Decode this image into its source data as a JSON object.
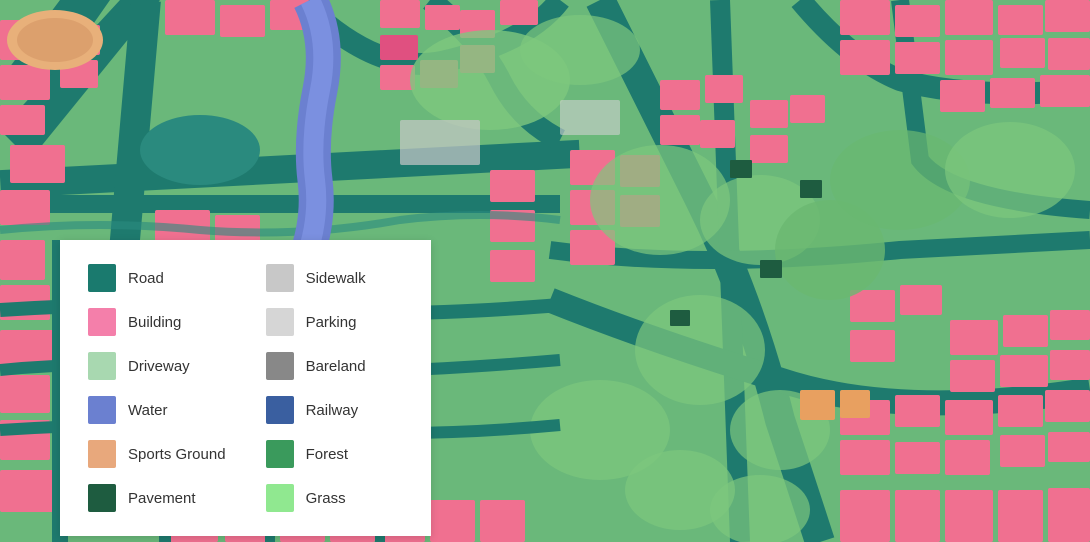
{
  "legend": {
    "items": [
      {
        "id": "road",
        "label": "Road",
        "color": "#1a7a6e"
      },
      {
        "id": "sidewalk",
        "label": "Sidewalk",
        "color": "#c8c8c8"
      },
      {
        "id": "building",
        "label": "Building",
        "color": "#f47faa"
      },
      {
        "id": "parking",
        "label": "Parking",
        "color": "#d6d6d6"
      },
      {
        "id": "driveway",
        "label": "Driveway",
        "color": "#a8d8b0"
      },
      {
        "id": "bareland",
        "label": "Bareland",
        "color": "#888888"
      },
      {
        "id": "water",
        "label": "Water",
        "color": "#6b80d0"
      },
      {
        "id": "railway",
        "label": "Railway",
        "color": "#3a5fa0"
      },
      {
        "id": "sports-ground",
        "label": "Sports Ground",
        "color": "#e8a87c"
      },
      {
        "id": "forest",
        "label": "Forest",
        "color": "#3a9a5c"
      },
      {
        "id": "pavement",
        "label": "Pavement",
        "color": "#1e5c40"
      },
      {
        "id": "grass",
        "label": "Grass",
        "color": "#90e890"
      }
    ]
  }
}
